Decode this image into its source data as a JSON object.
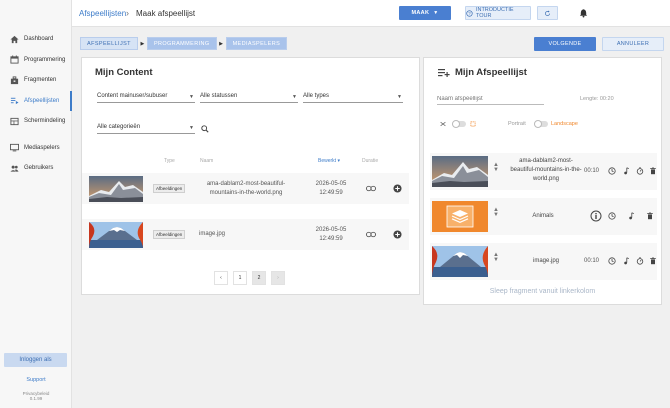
{
  "sidebar": {
    "items": [
      {
        "label": "Dashboard",
        "icon": "home-icon"
      },
      {
        "label": "Programmering",
        "icon": "calendar-icon"
      },
      {
        "label": "Fragmenten",
        "icon": "briefcase-icon"
      },
      {
        "label": "Afspeellijsten",
        "icon": "playlist-icon",
        "active": true
      },
      {
        "label": "Schermindeling",
        "icon": "layout-icon"
      },
      {
        "label": "Mediaspelers",
        "icon": "monitor-icon"
      },
      {
        "label": "Gebruikers",
        "icon": "users-icon"
      }
    ],
    "login_label": "Inloggen als",
    "support_label": "Support",
    "privacy_label": "Privacybeleid",
    "version_label": "0.1.99"
  },
  "topbar": {
    "crumb_parent": "Afspeellijsten",
    "crumb_separator": "›",
    "crumb_current": "Maak afspeellijst",
    "maak_label": "MAAK",
    "tour_label": "INTRODUCTIE TOUR"
  },
  "steps": [
    "AFSPEELLIJST",
    "PROGRAMMERING",
    "MEDIASPELERS"
  ],
  "actions": {
    "next_label": "VOLGENDE",
    "cancel_label": "ANNULEER"
  },
  "content": {
    "title": "Mijn Content",
    "filter_owner": "Content mainuser/subuser",
    "filter_status": "Alle statussen",
    "filter_type": "Alle types",
    "filter_category": "Alle categorieën",
    "columns": {
      "type": "Type",
      "name": "Naam",
      "edited": "Bewerkt",
      "duration": "Duratie"
    },
    "rows": [
      {
        "type": "Afbeeldingen",
        "name": "ama-dablam2-most-beautiful-mountains-in-the-world.png",
        "date": "2026-05-05",
        "time": "12:49:59"
      },
      {
        "type": "Afbeeldingen",
        "name": "image.jpg",
        "date": "2026-05-05",
        "time": "12:49:59"
      }
    ],
    "pagination": {
      "prev": "‹",
      "pages": [
        "1",
        "2"
      ],
      "current": "2",
      "next": "›"
    }
  },
  "playlist": {
    "title": "Mijn Afspeellijst",
    "name_placeholder": "Naam afspeellijst",
    "length_label": "Lengte: 00:20",
    "portrait_label": "Portrait",
    "landscape_label": "Landscape",
    "items": [
      {
        "name": "ama-dablam2-most-beautiful-mountains-in-the-world.png",
        "duration": "00:10"
      },
      {
        "name": "Animals",
        "duration": ""
      },
      {
        "name": "image.jpg",
        "duration": "00:10"
      }
    ],
    "drag_hint": "Sleep fragment vanuit linkerkolom"
  },
  "colors": {
    "accent": "#4a7fd1",
    "orange": "#f0882d",
    "link": "#3d7cc9"
  }
}
